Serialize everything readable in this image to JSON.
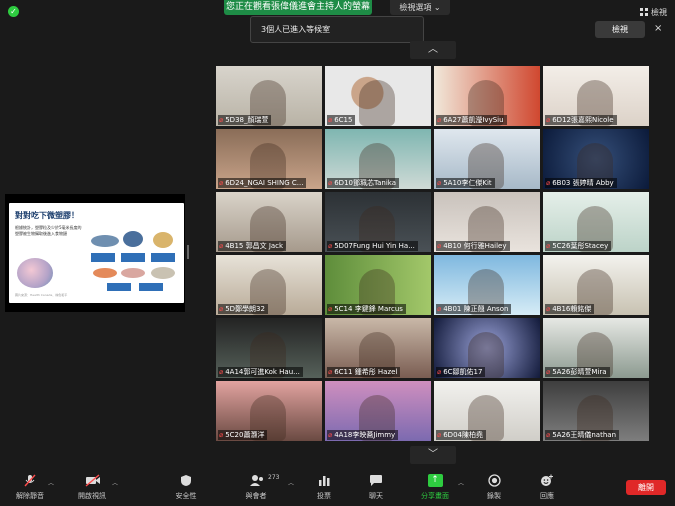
{
  "top": {
    "share_notice": "您正在觀看張偉儀進會主持人的螢幕",
    "view_options": "檢視選項",
    "view_button": "檢視"
  },
  "waiting": {
    "text": "3個人已進入等候室",
    "view_button": "檢視",
    "close": "×"
  },
  "nav": {
    "up": "︿",
    "down": "﹀"
  },
  "slide": {
    "title": "對對吃下微塑膠！",
    "body": "根據統計，塑膠粒及少於5毫米長度的塑膠被生物攝取後進入食物鏈",
    "footer": "圖片來源：Health Canada、綠色和平"
  },
  "participants": [
    {
      "name": "5D38_顏瑞萱"
    },
    {
      "name": "6C15"
    },
    {
      "name": "6A27蕭凱瀅IvySiu"
    },
    {
      "name": "6D12張嘉熙Nicole"
    },
    {
      "name": "6D24_NGAI SHING C..."
    },
    {
      "name": "6D10鄧珮芯Tanika"
    },
    {
      "name": "5A10李仁傑Kit"
    },
    {
      "name": "6B03 張婷晴 Abby"
    },
    {
      "name": "4B15 郭昌文 Jack"
    },
    {
      "name": "5D07Fung Hui Yin Ha..."
    },
    {
      "name": "4B10 何行雅Hailey"
    },
    {
      "name": "5C26葉彤Stacey"
    },
    {
      "name": "5D鄭學朗32"
    },
    {
      "name": "5C14 李鍵鋒 Marcus"
    },
    {
      "name": "4B01 陳正翹 Anson"
    },
    {
      "name": "4B16賴銘傑"
    },
    {
      "name": "4A14郭可進Kok Hau..."
    },
    {
      "name": "6C11 鍾希彤 Hazel"
    },
    {
      "name": "6C鄒凱佑17"
    },
    {
      "name": "5A26彭晴萱Mira"
    },
    {
      "name": "5C20蕭灏洋"
    },
    {
      "name": "4A18李映蕎Jimmy"
    },
    {
      "name": "6D04陳柏堯"
    },
    {
      "name": "5A26王晴儀nathan"
    }
  ],
  "toolbar": {
    "unmute": "解除靜音",
    "start_video": "開啟視訊",
    "security": "安全性",
    "participants": "與會者",
    "participant_count": "273",
    "polls": "投票",
    "chat": "聊天",
    "share_screen": "分享畫面",
    "record": "錄製",
    "reactions": "回應",
    "end": "離開"
  }
}
